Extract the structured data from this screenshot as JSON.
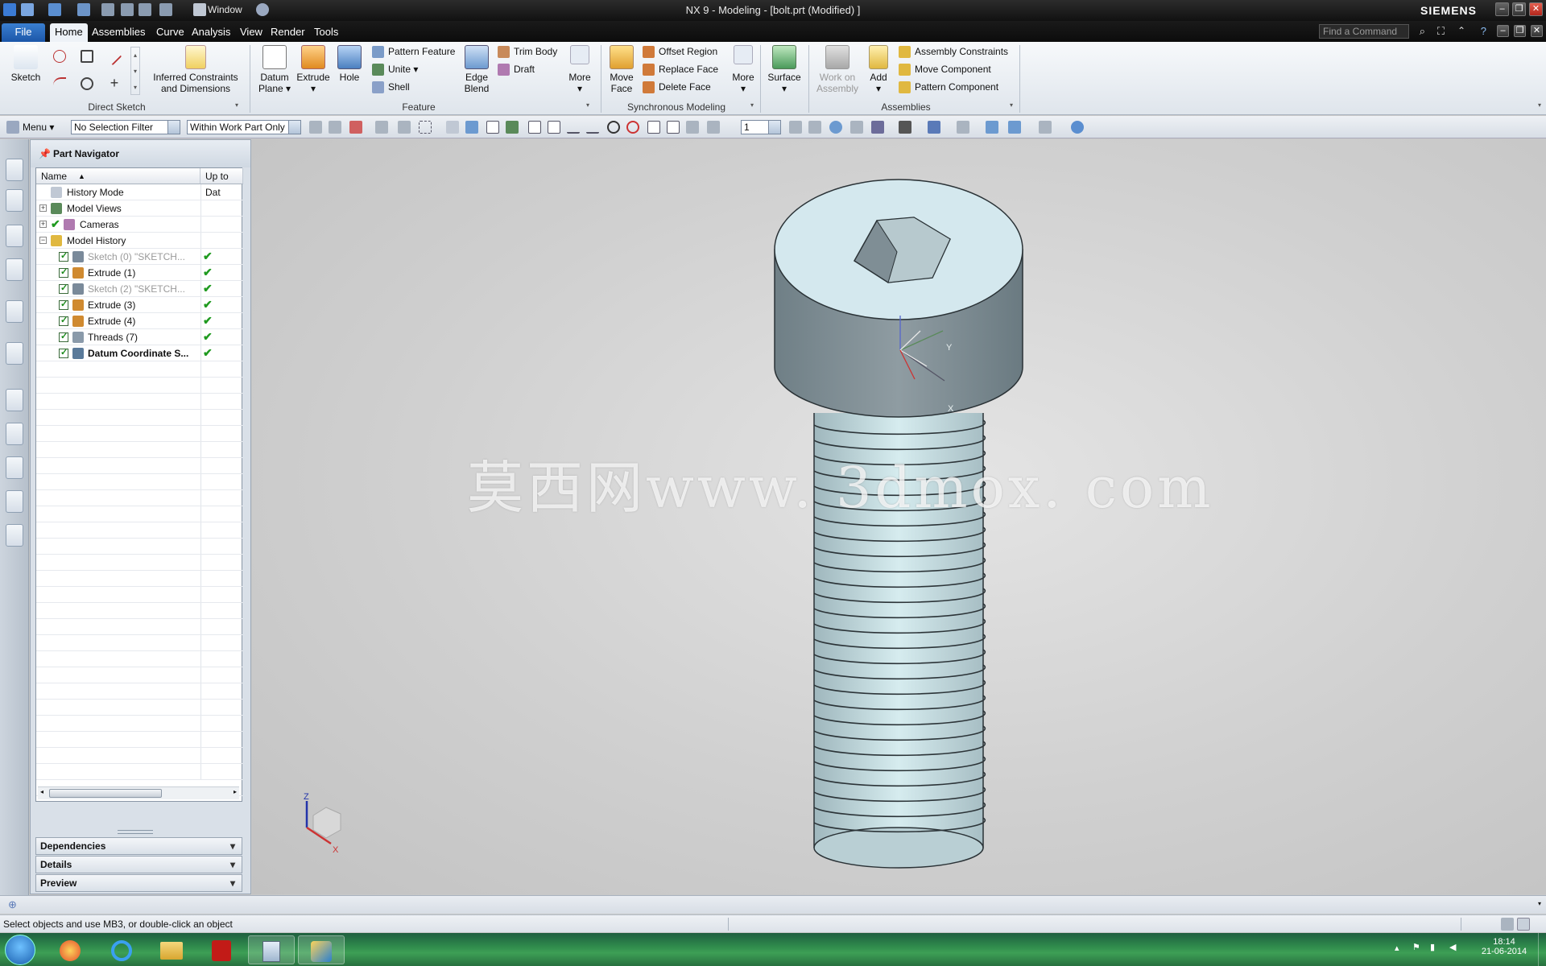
{
  "window": {
    "title": "NX 9 - Modeling - [bolt.prt (Modified) ]",
    "brand": "SIEMENS",
    "quick_access": {
      "window_menu": "Window"
    }
  },
  "menu_tabs": [
    "File",
    "Home",
    "Assemblies",
    "Curve",
    "Analysis",
    "View",
    "Render",
    "Tools"
  ],
  "find_command": {
    "placeholder": "Find a Command"
  },
  "ribbon": {
    "direct_sketch": {
      "label": "Direct Sketch",
      "sketch": "Sketch",
      "inferred_line1": "Inferred Constraints",
      "inferred_line2": "and Dimensions"
    },
    "feature": {
      "label": "Feature",
      "datum_line1": "Datum",
      "datum_line2": "Plane",
      "extrude": "Extrude",
      "hole": "Hole",
      "pattern_feature": "Pattern Feature",
      "unite": "Unite",
      "shell": "Shell",
      "edge_line1": "Edge",
      "edge_line2": "Blend",
      "trim_body": "Trim Body",
      "draft": "Draft",
      "more": "More"
    },
    "sync": {
      "label": "Synchronous Modeling",
      "move_line1": "Move",
      "move_line2": "Face",
      "offset_region": "Offset Region",
      "replace_face": "Replace Face",
      "delete_face": "Delete Face",
      "more": "More",
      "surface": "Surface"
    },
    "assemblies": {
      "label": "Assemblies",
      "woa_line1": "Work on",
      "woa_line2": "Assembly",
      "add": "Add",
      "assembly_constraints": "Assembly Constraints",
      "move_component": "Move Component",
      "pattern_component": "Pattern Component"
    }
  },
  "toolbar": {
    "menu": "Menu",
    "selection_filter": "No Selection Filter",
    "scope": "Within Work Part Only",
    "layer": "1"
  },
  "navigator": {
    "title": "Part Navigator",
    "col_name": "Name",
    "col_uptodate": "Up to Dat",
    "items": [
      {
        "label": "History Mode",
        "indent": 0,
        "state": "none",
        "grey": false,
        "bold": false
      },
      {
        "label": "Model Views",
        "indent": 0,
        "state": "none",
        "grey": false,
        "bold": false
      },
      {
        "label": "Cameras",
        "indent": 0,
        "state": "none",
        "grey": false,
        "bold": false
      },
      {
        "label": "Model History",
        "indent": 0,
        "state": "none",
        "grey": false,
        "bold": false
      },
      {
        "label": "Sketch (0) \"SKETCH...",
        "indent": 1,
        "state": "ok",
        "grey": true,
        "bold": false
      },
      {
        "label": "Extrude (1)",
        "indent": 1,
        "state": "ok",
        "grey": false,
        "bold": false
      },
      {
        "label": "Sketch (2) \"SKETCH...",
        "indent": 1,
        "state": "ok",
        "grey": true,
        "bold": false
      },
      {
        "label": "Extrude (3)",
        "indent": 1,
        "state": "ok",
        "grey": false,
        "bold": false
      },
      {
        "label": "Extrude (4)",
        "indent": 1,
        "state": "ok",
        "grey": false,
        "bold": false
      },
      {
        "label": "Threads (7)",
        "indent": 1,
        "state": "ok",
        "grey": false,
        "bold": false
      },
      {
        "label": "Datum Coordinate S...",
        "indent": 1,
        "state": "ok",
        "grey": false,
        "bold": true
      }
    ],
    "panels": [
      "Dependencies",
      "Details",
      "Preview"
    ]
  },
  "viewport": {
    "watermark": "莫西网www. 3dmox. com",
    "triad_axes": {
      "x": "X",
      "y": "Y",
      "z": "Z"
    }
  },
  "status": {
    "cue": "Select objects and use MB3, or double-click an object"
  },
  "taskbar": {
    "time": "18:14",
    "date": "21-06-2014"
  }
}
